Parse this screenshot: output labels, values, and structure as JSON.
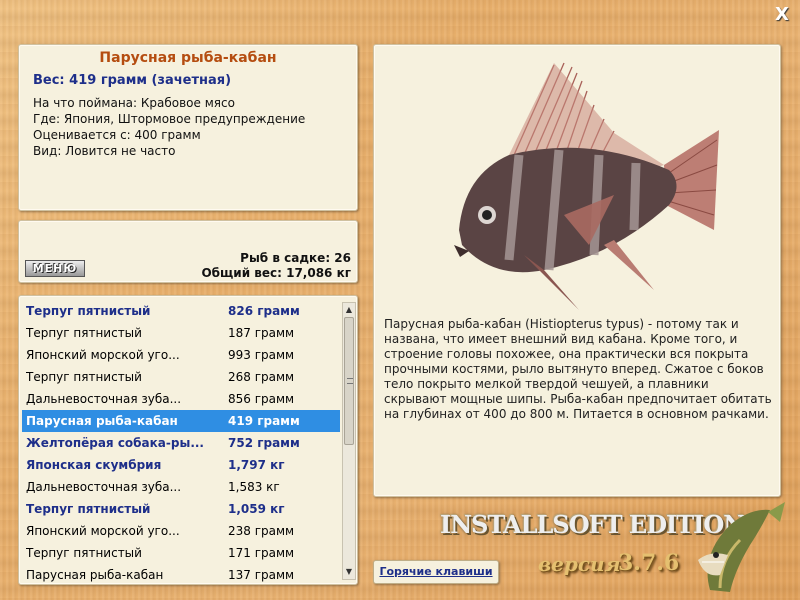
{
  "window": {
    "close_label": "X"
  },
  "info": {
    "title": "Парусная рыба-кабан",
    "weight": "Вес: 419 грамм (зачетная)",
    "lines": [
      "На что поймана: Крабовое мясо",
      "Где: Япония, Штормовое предупреждение",
      "Оценивается с: 400 грамм",
      "Вид: Ловится не часто"
    ]
  },
  "status": {
    "menu_label": "МЕНЮ",
    "fish_count": "Рыб в садке: 26",
    "total_weight": "Общий вес: 17,086 кг"
  },
  "fish_list": [
    {
      "name": "Терпуг пятнистый",
      "weight": "826 грамм",
      "bold": true,
      "selected": false
    },
    {
      "name": "Терпуг пятнистый",
      "weight": "187 грамм",
      "bold": false,
      "selected": false
    },
    {
      "name": "Японский морской уго...",
      "weight": "993 грамм",
      "bold": false,
      "selected": false
    },
    {
      "name": "Терпуг пятнистый",
      "weight": "268 грамм",
      "bold": false,
      "selected": false
    },
    {
      "name": "Дальневосточная зуба...",
      "weight": "856 грамм",
      "bold": false,
      "selected": false
    },
    {
      "name": "Парусная рыба-кабан",
      "weight": "419 грамм",
      "bold": true,
      "selected": true
    },
    {
      "name": "Желтопёрая собака-ры...",
      "weight": "752 грамм",
      "bold": true,
      "selected": false
    },
    {
      "name": "Японская скумбрия",
      "weight": "1,797 кг",
      "bold": true,
      "selected": false
    },
    {
      "name": "Дальневосточная зуба...",
      "weight": "1,583 кг",
      "bold": false,
      "selected": false
    },
    {
      "name": "Терпуг пятнистый",
      "weight": "1,059 кг",
      "bold": true,
      "selected": false
    },
    {
      "name": "Японский морской уго...",
      "weight": "238 грамм",
      "bold": false,
      "selected": false
    },
    {
      "name": "Терпуг пятнистый",
      "weight": "171 грамм",
      "bold": false,
      "selected": false
    },
    {
      "name": "Парусная рыба-кабан",
      "weight": "137 грамм",
      "bold": false,
      "selected": false
    }
  ],
  "description": "Парусная рыба-кабан (Histiopterus typus) - потому так и названа, что имеет внешний вид кабана. Кроме того, и строение головы похожее, она практически вся покрыта прочными костями, рыло вытянуто вперед. Сжатое с боков тело покрыто мелкой твердой чешуей, а плавники скрывают мощные шипы. Рыба-кабан предпочитает обитать на глубинах от 400 до 800 м. Питается в основном рачками.",
  "hotkeys_label": "Горячие клавиши",
  "branding": {
    "edition": "INSTALLSOFT EDITION",
    "version_label": "версия",
    "version_number": "3.7.6"
  },
  "colors": {
    "title": "#b54d10",
    "accent_blue": "#1e2f8a",
    "selection": "#2f8ee3",
    "panel": "#f6f1de"
  }
}
